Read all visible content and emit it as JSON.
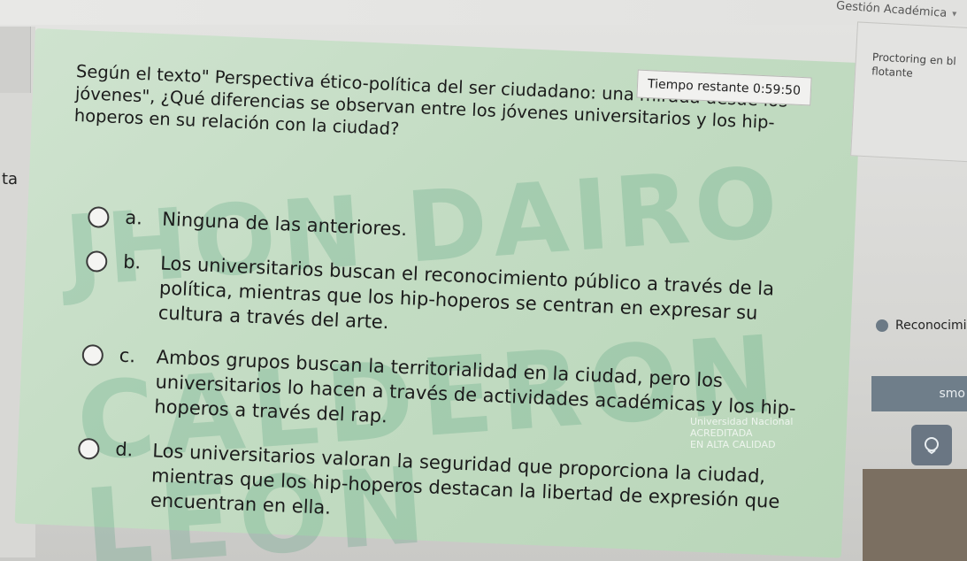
{
  "header": {
    "user_menu_label": "Gestión Académica",
    "user_menu_chevron": "chevron-down-icon"
  },
  "left_fragment": "ta",
  "timer": {
    "label": "Tiempo restante 0:59:50"
  },
  "question": {
    "text": "Según el texto\" Perspectiva ético-política del ser ciudadano: una mirada desde los jóvenes\", ¿Qué diferencias se observan entre los jóvenes universitarios y los hip-hoperos en su relación con la ciudad?"
  },
  "options": [
    {
      "letter": "a.",
      "text": "Ninguna de las anteriores."
    },
    {
      "letter": "b.",
      "text": "Los universitarios buscan el reconocimiento público a través de la política, mientras que los hip-hoperos se centran en expresar su cultura a través del arte."
    },
    {
      "letter": "c.",
      "text": "Ambos grupos buscan la territorialidad en la ciudad, pero los universitarios lo hacen a través de actividades académicas y los hip-hoperos a través del rap."
    },
    {
      "letter": "d.",
      "text": "Los universitarios valoran la seguridad que proporciona la ciudad, mientras que los hip-hoperos destacan la libertad de expresión que encuentran en ella."
    }
  ],
  "watermark": {
    "line1": "JHON DAIRO",
    "line2": "CALDERON LEON"
  },
  "seal": {
    "line1": "Universidad Nacional",
    "line2": "ACREDITADA",
    "line3": "EN ALTA CALIDAD"
  },
  "right_panel": {
    "proctoring_text": "Proctoring en bl flotante",
    "reconocimiento_label": "Reconocimi",
    "button_label": "smo"
  }
}
